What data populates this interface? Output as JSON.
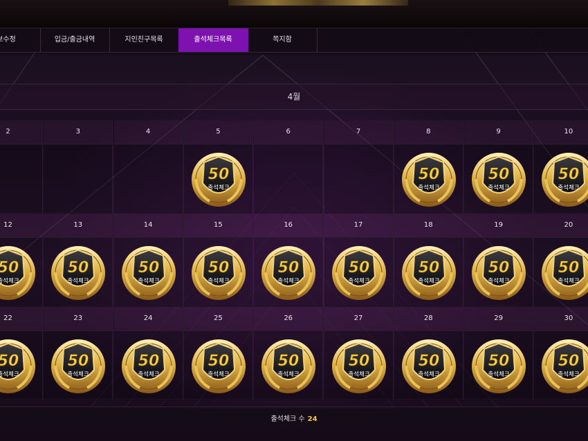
{
  "tabs": [
    {
      "label": "보수정",
      "active": false
    },
    {
      "label": "입금/출금내역",
      "active": false
    },
    {
      "label": "지인친구목록",
      "active": false
    },
    {
      "label": "출석체크목록",
      "active": true
    },
    {
      "label": "쪽지함",
      "active": false
    }
  ],
  "calendar": {
    "month": "4월",
    "stamp_number": "50",
    "stamp_label": "출석체크",
    "days": [
      {
        "day": "2",
        "checked": false
      },
      {
        "day": "3",
        "checked": false
      },
      {
        "day": "4",
        "checked": false
      },
      {
        "day": "5",
        "checked": true
      },
      {
        "day": "6",
        "checked": false
      },
      {
        "day": "7",
        "checked": false
      },
      {
        "day": "8",
        "checked": true
      },
      {
        "day": "9",
        "checked": true
      },
      {
        "day": "10",
        "checked": true
      },
      {
        "day": "12",
        "checked": true
      },
      {
        "day": "13",
        "checked": true
      },
      {
        "day": "14",
        "checked": true
      },
      {
        "day": "15",
        "checked": true
      },
      {
        "day": "16",
        "checked": true
      },
      {
        "day": "17",
        "checked": true
      },
      {
        "day": "18",
        "checked": true
      },
      {
        "day": "19",
        "checked": true
      },
      {
        "day": "20",
        "checked": true
      },
      {
        "day": "22",
        "checked": true
      },
      {
        "day": "23",
        "checked": true
      },
      {
        "day": "24",
        "checked": true
      },
      {
        "day": "25",
        "checked": true
      },
      {
        "day": "26",
        "checked": true
      },
      {
        "day": "27",
        "checked": true
      },
      {
        "day": "28",
        "checked": true
      },
      {
        "day": "29",
        "checked": true
      },
      {
        "day": "30",
        "checked": true
      }
    ]
  },
  "footer": {
    "label": "출석체크 수",
    "count": "24"
  },
  "colors": {
    "active_tab": "#7d12b0",
    "count_highlight": "#f2c744",
    "badge_gold": "#d4a437"
  }
}
